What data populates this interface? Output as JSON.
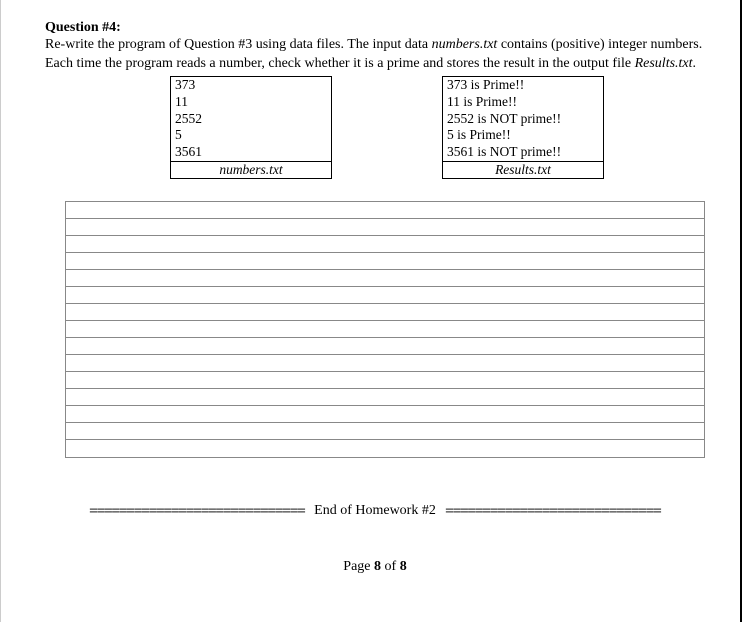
{
  "question": {
    "title": "Question #4:",
    "body_pre": "Re-write the program of Question #3 using data files. The input data ",
    "body_file1": "numbers.txt",
    "body_mid1": " contains (positive) integer numbers. Each time the program reads a number, check whether it is a prime and stores the result in the output file ",
    "body_file2": "Results.txt",
    "body_post": "."
  },
  "files": {
    "left": {
      "lines": [
        "373",
        "11",
        "2552",
        "5",
        "3561"
      ],
      "caption": "numbers.txt"
    },
    "right": {
      "lines": [
        "373 is Prime!!",
        "11 is Prime!!",
        "2552 is NOT prime!!",
        "5 is Prime!!",
        "3561 is NOT prime!!"
      ],
      "caption": "Results.txt"
    }
  },
  "end_label": "End of Homework #2",
  "end_dashes_left": "============================= ",
  "end_dashes_right": " =============================",
  "footer": {
    "pre": "Page ",
    "current": "8",
    "mid": " of ",
    "total": "8"
  },
  "blank_lines_count": 15
}
